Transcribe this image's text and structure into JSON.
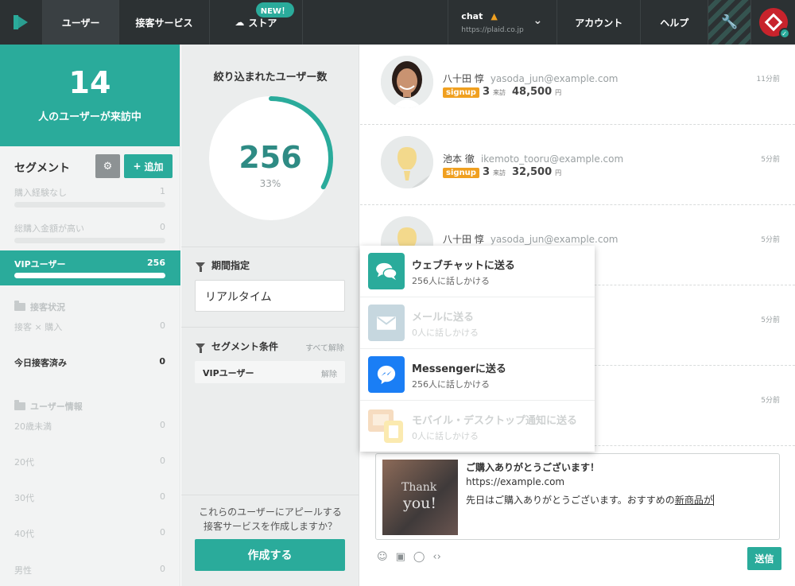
{
  "topbar": {
    "nav_users": "ユーザー",
    "nav_service": "接客サービス",
    "nav_store": "ストア",
    "store_badge": "NEW！",
    "chat_name": "chat",
    "chat_url": "https://plaid.co.jp",
    "nav_account": "アカウント",
    "nav_help": "ヘルプ"
  },
  "visitors": {
    "count": "14",
    "label": "人のユーザーが来訪中"
  },
  "segments": {
    "title": "セグメント",
    "add_label": "追加",
    "items": [
      {
        "name": "購入経験なし",
        "count": "1"
      },
      {
        "name": "総購入金額が高い",
        "count": "0"
      },
      {
        "name": "VIPユーザー",
        "count": "256"
      },
      {
        "name": "接客 × 購入",
        "count": "0"
      },
      {
        "name": "今日接客済み",
        "count": "0"
      },
      {
        "name": "20歳未満",
        "count": "0"
      },
      {
        "name": "20代",
        "count": "0"
      },
      {
        "name": "30代",
        "count": "0"
      },
      {
        "name": "40代",
        "count": "0"
      },
      {
        "name": "男性",
        "count": "0"
      }
    ],
    "groups": [
      "接客状況",
      "ユーザー情報"
    ]
  },
  "filtered": {
    "title": "絞り込まれたユーザー数",
    "count": "256",
    "percent": "33%",
    "fraction": 0.33,
    "period_title": "期間指定",
    "period_value": "リアルタイム",
    "cond_title": "セグメント条件",
    "clear_all": "すべて解除",
    "cond_name": "VIPユーザー",
    "cond_remove": "解除",
    "appeal_line1": "これらのユーザーにアピールする",
    "appeal_line2": "接客サービスを作成しますか？",
    "create_label": "作成する"
  },
  "users": [
    {
      "name": "八十田 惇",
      "email": "yasoda_jun@example.com",
      "badge": "signup",
      "visits": "3",
      "visits_unit": "来訪",
      "amount": "48,500",
      "amount_unit": "円",
      "time": "11分前"
    },
    {
      "name": "池本 徹",
      "email": "ikemoto_tooru@example.com",
      "badge": "signup",
      "visits": "3",
      "visits_unit": "来訪",
      "amount": "32,500",
      "amount_unit": "円",
      "time": "5分前"
    },
    {
      "name": "八十田 惇",
      "email": "yasoda_jun@example.com",
      "time": "5分前"
    },
    {
      "time": "5分前"
    },
    {
      "time": "5分前"
    }
  ],
  "menu": [
    {
      "title": "ウェブチャットに送る",
      "sub": "256人に話しかける"
    },
    {
      "title": "メールに送る",
      "sub": "0人に話しかける"
    },
    {
      "title": "Messengerに送る",
      "sub": "256人に話しかける"
    },
    {
      "title": "モバイル・デスクトップ通知に送る",
      "sub": "0人に話しかける"
    }
  ],
  "composer": {
    "thumb_line1": "Thank",
    "thumb_line2": "you!",
    "title": "ご購入ありがとうございます！",
    "url": "https://example.com",
    "body_main": "先日はご購入ありがとうございます。おすすめの",
    "body_underlined": "新商品が",
    "send_label": "送信"
  },
  "colors": {
    "accent": "#2aab9b",
    "topbar": "#2c3133",
    "badge": "#f0a020",
    "messenger": "#1a7ef5",
    "warning": "#f0a020"
  }
}
